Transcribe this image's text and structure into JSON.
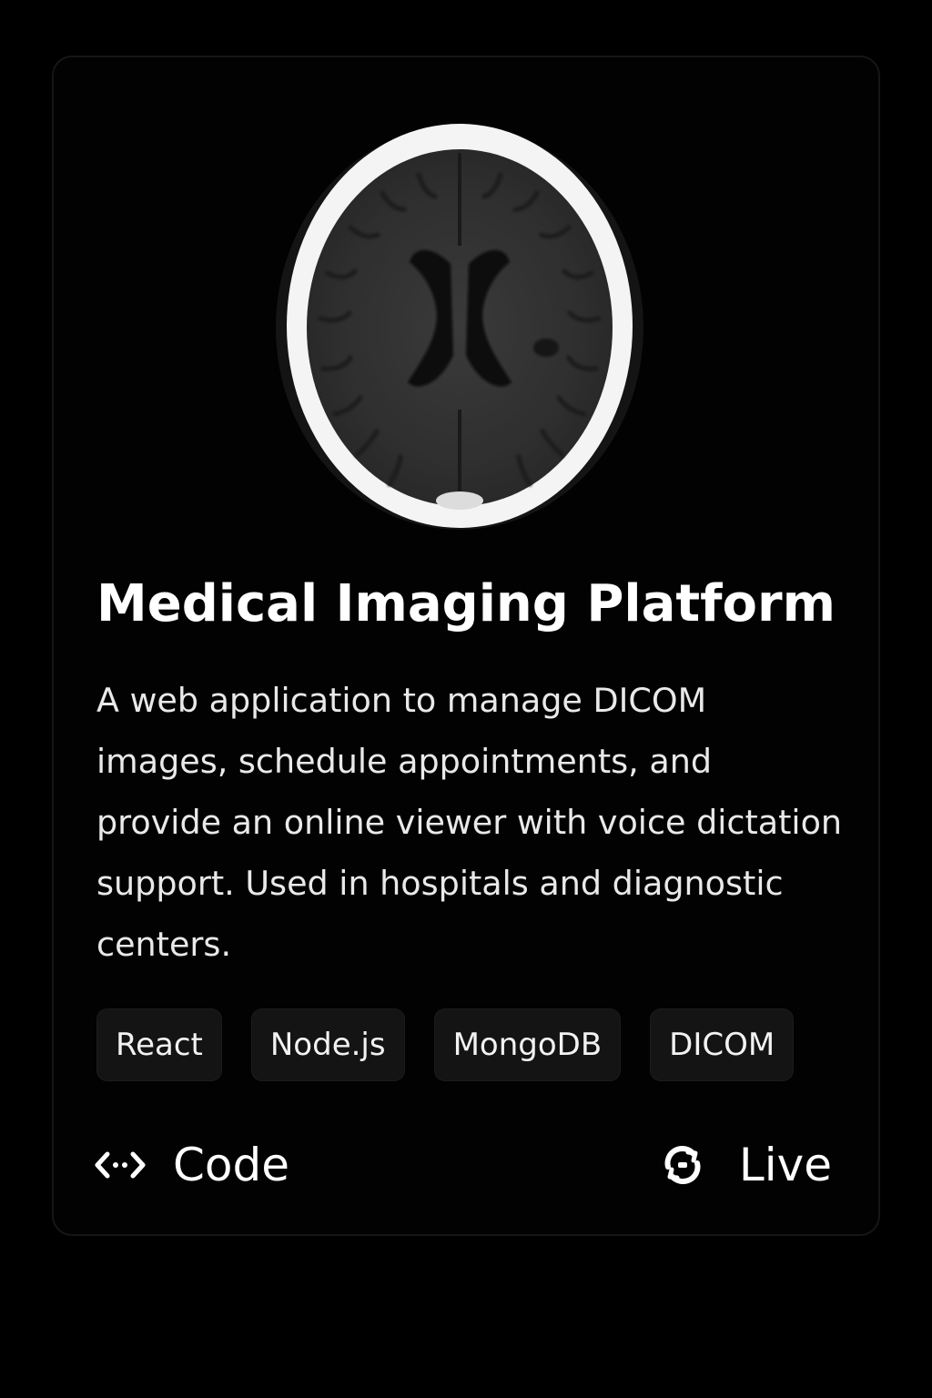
{
  "project": {
    "title": "Medical Imaging Platform",
    "description": "A web application to manage DICOM images, schedule appointments, and provide an online viewer with voice dictation support. Used in hospitals and diagnostic centers.",
    "image": "brain-ct-scan",
    "tags": [
      "React",
      "Node.js",
      "MongoDB",
      "DICOM"
    ]
  },
  "links": {
    "code": {
      "label": "Code",
      "icon": "code-icon"
    },
    "live": {
      "label": "Live",
      "icon": "link-icon"
    }
  },
  "colors": {
    "background": "#000000",
    "card_background": "#020202",
    "card_border": "#161616",
    "tag_background": "#141414",
    "text": "#ffffff"
  }
}
